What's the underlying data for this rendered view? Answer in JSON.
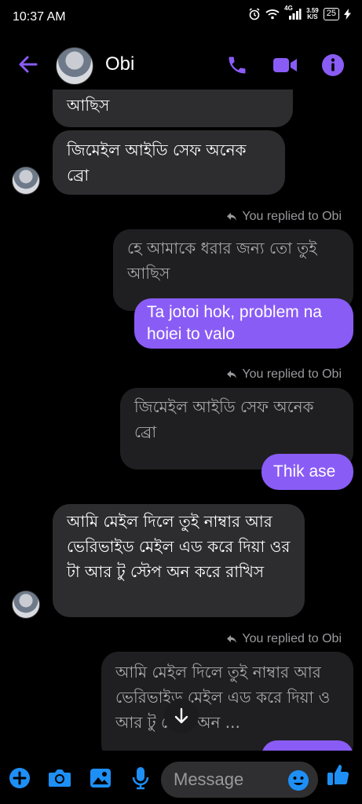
{
  "status_bar": {
    "time": "10:37 AM",
    "network": "4G",
    "net_speed_value": "3.59",
    "net_speed_unit": "K/S",
    "battery": "25"
  },
  "header": {
    "contact_name": "Obi",
    "icons": [
      "back-arrow-icon",
      "phone-icon",
      "video-camera-icon",
      "info-icon"
    ],
    "accent_color": "#8a5cf6"
  },
  "messages": {
    "m1_text": "আছিস",
    "m2_text": "জিমেইল আইডি সেফ অনেক ব্রো",
    "reply1_note": "You replied to Obi",
    "reply1_quote": "হে আমাকে ধরার জন্য তো তুই আছিস",
    "reply1_text": "Ta jotoi hok, problem na hoiei to valo",
    "reply2_note": "You replied to Obi",
    "reply2_quote": "জিমেইল আইডি সেফ অনেক ব্রো",
    "reply2_text": "Thik ase",
    "m3_text": "আমি মেইল দিলে তুই নাম্বার আর ভেরিভাইড মেইল এড করে দিয়া ওর টা আর টু স্টেপ অন করে রাখিস",
    "reply3_note": "You replied to Obi",
    "reply3_quote": "আমি মেইল দিলে তুই নাম্বার আর ভেরিভাইড মেইল এড করে দিয়া ও    আর টু স্টেপ অন ..."
  },
  "composer": {
    "placeholder": "Message",
    "icons": [
      "plus-icon",
      "camera-icon",
      "image-icon",
      "microphone-icon",
      "emoji-icon",
      "thumbs-up-icon"
    ]
  }
}
